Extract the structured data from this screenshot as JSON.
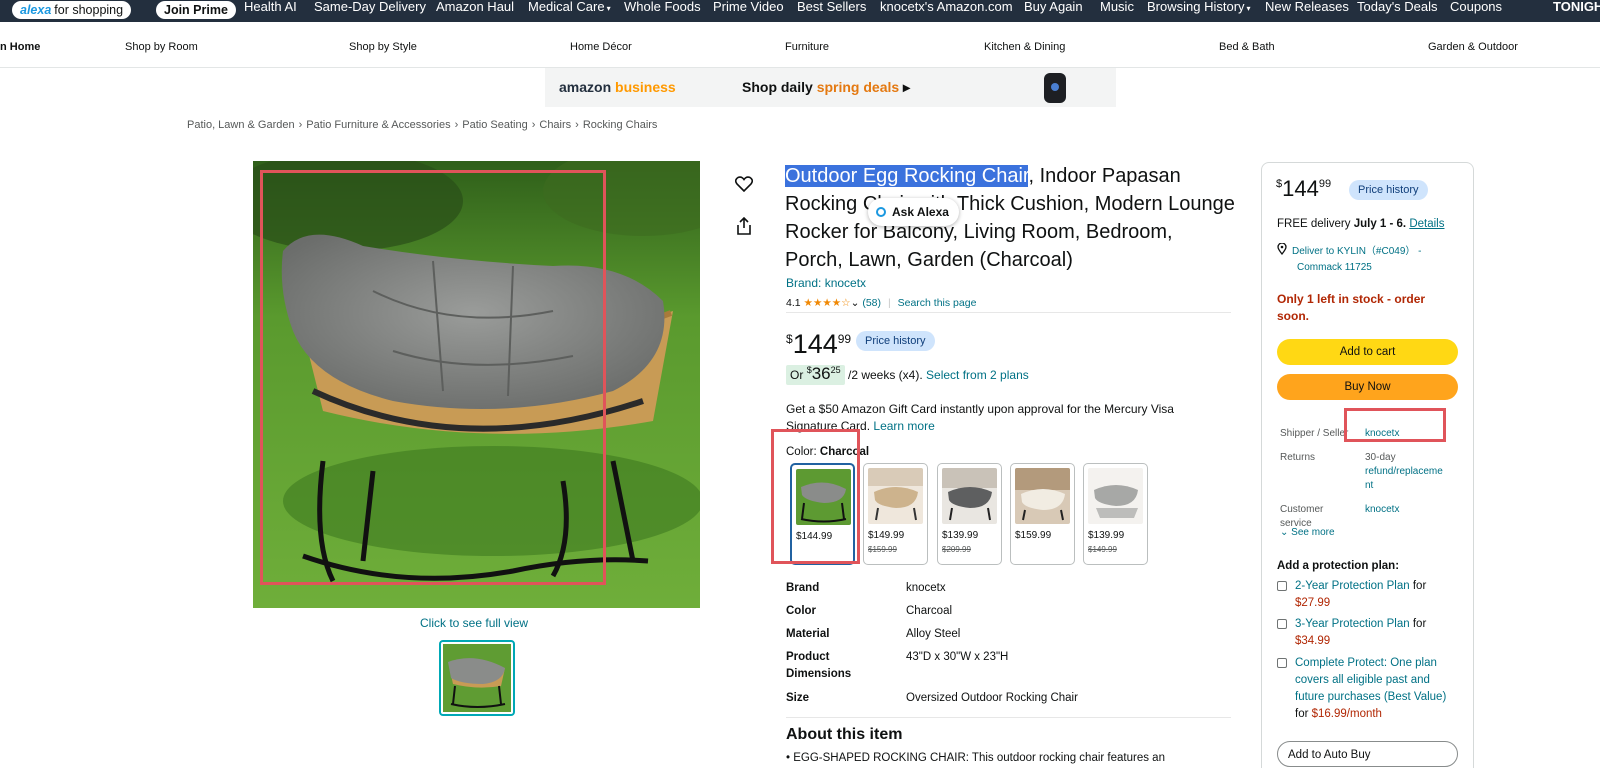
{
  "topnav": {
    "alexa_word": "alexa",
    "alexa_rest": "for shopping",
    "join_prime": "Join Prime",
    "links": [
      "Health AI",
      "Same-Day Delivery",
      "Amazon Haul",
      "Medical Care",
      "Whole Foods",
      "Prime Video",
      "Best Sellers",
      "knocetx's Amazon.com",
      "Buy Again",
      "Music",
      "Browsing History",
      "New Releases",
      "Today's Deals",
      "Coupons"
    ],
    "tonight": "TONIGH"
  },
  "catbar": [
    "n Home",
    "Shop by Room",
    "Shop by Style",
    "Home Décor",
    "Furniture",
    "Kitchen & Dining",
    "Bed & Bath",
    "Garden & Outdoor"
  ],
  "banner": {
    "biz_word": "amazon",
    "biz_word2": "business",
    "deal_a": "Shop daily",
    "deal_b": "spring deals",
    "deal_arrow": "▸"
  },
  "breadcrumb": [
    "Patio, Lawn & Garden",
    "Patio Furniture & Accessories",
    "Patio Seating",
    "Chairs",
    "Rocking Chairs"
  ],
  "breadcrumb_sep": "›",
  "image": {
    "full_view": "Click to see full view"
  },
  "product": {
    "title_selected": "Outdoor Egg Rocking Chair",
    "title_rest": ", Indoor Papasan Rocking Chair with Thick Cushion, Modern Lounge Rocker for Balcony, Living Room, Bedroom, Porch, Lawn, Garden (Charcoal)",
    "ask_alexa": "Ask Alexa",
    "brand_link": "Brand: knocetx",
    "rating_value": "4.1",
    "rating_stars": "★★★★☆",
    "rating_caret": "⌄",
    "rating_count": "(58)",
    "search_page": "Search this page",
    "price_currency": "$",
    "price_whole": "144",
    "price_fraction": "99",
    "price_history": "Price history",
    "install_or": "Or",
    "install_currency": "$",
    "install_whole": "36",
    "install_fraction": "25",
    "install_terms": "/2 weeks (x4).",
    "install_link": "Select from 2 plans",
    "gift_text": "Get a $50 Amazon Gift Card instantly upon approval for the Mercury Visa Signature Card.",
    "gift_link": "Learn more",
    "color_label": "Color:",
    "color_value": "Charcoal"
  },
  "swatches": [
    {
      "price": "$144.99",
      "old": ""
    },
    {
      "price": "$149.99",
      "old": "$159.99"
    },
    {
      "price": "$139.99",
      "old": "$209.99"
    },
    {
      "price": "$159.99",
      "old": ""
    },
    {
      "price": "$139.99",
      "old": "$149.99"
    }
  ],
  "specs": [
    {
      "key": "Brand",
      "value": "knocetx"
    },
    {
      "key": "Color",
      "value": "Charcoal"
    },
    {
      "key": "Material",
      "value": "Alloy Steel"
    },
    {
      "key": "Product Dimensions",
      "value": "43\"D x 30\"W x 23\"H"
    },
    {
      "key": "Size",
      "value": "Oversized Outdoor Rocking Chair"
    }
  ],
  "about": {
    "title": "About this item",
    "bullet1": "• EGG-SHAPED ROCKING CHAIR: This outdoor rocking chair features an"
  },
  "buybox": {
    "price_currency": "$",
    "price_whole": "144",
    "price_fraction": "99",
    "price_history": "Price history",
    "delivery_text": "FREE delivery",
    "delivery_date": "July 1 - 6.",
    "delivery_details": "Details",
    "deliver_to": "Deliver to KYLIN（#C049） -",
    "deliver_city": "Commack 11725",
    "stock_line1": "Only 1 left in stock - order",
    "stock_line2": "soon.",
    "add_to_cart": "Add to cart",
    "buy_now": "Buy Now",
    "shipper_label": "Shipper / Seller",
    "shipper_value": "knocetx",
    "returns_label": "Returns",
    "returns_value_1": "30-day",
    "returns_value_2": "refund/replaceme",
    "returns_value_3": "nt",
    "cs_label_1": "Customer",
    "cs_label_2": "service",
    "cs_value": "knocetx",
    "see_more": "See more",
    "see_more_caret": "⌄",
    "protection_title": "Add a protection plan:",
    "plan1_name": "2-Year Protection Plan",
    "plan1_for": "for",
    "plan1_price": "$27.99",
    "plan2_name": "3-Year Protection Plan",
    "plan2_for": "for",
    "plan2_price": "$34.99",
    "plan3_name": "Complete Protect: One plan covers all eligible past and future purchases (Best Value)",
    "plan3_for": "for",
    "plan3_price": "$16.99/month",
    "auto_buy": "Add to Auto Buy"
  },
  "colors": {
    "nav_bg": "#232f3e",
    "link": "#007185",
    "add_to_cart": "#ffd814",
    "buy_now": "#ffa41c",
    "stock": "#b12704",
    "highlight": "#e0545a",
    "selection": "#3b72dd",
    "price_badge": "#cfe4fc"
  },
  "icons": {
    "wishlist": "heart-icon",
    "share": "share-icon",
    "location": "location-pin-icon"
  }
}
